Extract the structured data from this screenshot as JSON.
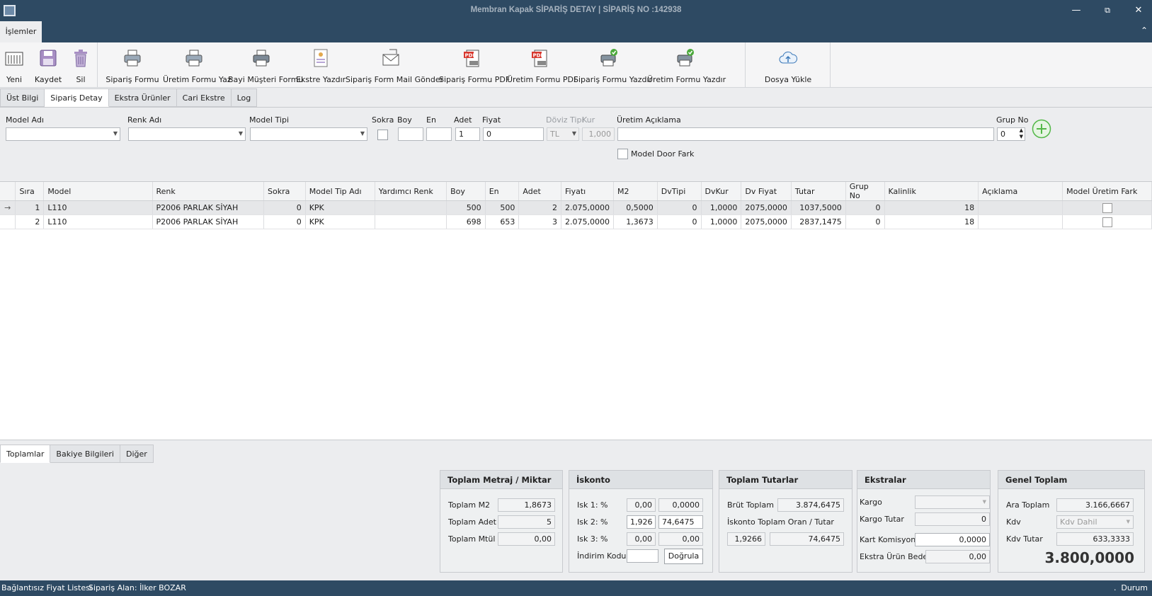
{
  "window": {
    "title": "Membran Kapak SİPARİŞ DETAY |  SİPARİŞ NO :142938"
  },
  "menu": {
    "tab": "İşlemler"
  },
  "toolbar": {
    "yeni": "Yeni",
    "kaydet": "Kaydet",
    "sil": "Sil",
    "siparis_formu": "Sipariş Formu",
    "uretim_formu_yaz": "Üretim Formu Yaz",
    "bayi_musteri_formu": "Bayi Müşteri Formu",
    "ekstre_yazdir": "Ekstre Yazdır",
    "siparis_form_mail": "Sipariş Form Mail Gönder",
    "siparis_formu_pdf": "Sipariş Formu PDF",
    "uretim_formu_pdf": "Üretim Formu PDF",
    "siparis_formu_yazdir": "Sipariş Formu Yazdır",
    "uretim_formu_yazdir": "Üretim Formu Yazdır",
    "dosya_yukle": "Dosya Yükle"
  },
  "tabs": [
    "Üst Bilgi",
    "Sipariş Detay",
    "Ekstra Ürünler",
    "Cari Ekstre",
    "Log"
  ],
  "form": {
    "model_adi": "Model Adı",
    "renk_adi": "Renk Adı",
    "model_tipi": "Model Tipi",
    "sokra": "Sokra",
    "boy": "Boy",
    "en": "En",
    "adet": "Adet",
    "fiyat": "Fiyat",
    "doviz_tipi": "Döviz Tipi",
    "kur": "Kur",
    "uretim_aciklama": "Üretim Açıklama",
    "grup_no": "Grup No",
    "adet_value": "1",
    "fiyat_value": "0",
    "doviz_value": "TL",
    "kur_value": "1,000",
    "grup_value": "0",
    "model_door_fark": "Model Door Fark"
  },
  "grid": {
    "columns": [
      "Sıra",
      "Model",
      "Renk",
      "Sokra",
      "Model Tip Adı",
      "Yardımcı Renk",
      "Boy",
      "En",
      "Adet",
      "Fiyatı",
      "M2",
      "DvTipi",
      "DvKur",
      "Dv Fiyat",
      "Tutar",
      "Grup No",
      "Kalinlik",
      "Açıklama",
      "Model Üretim Fark"
    ],
    "rows": [
      [
        "1",
        "L110",
        "P2006 PARLAK SİYAH",
        "0",
        "KPK",
        "",
        "500",
        "500",
        "2",
        "2.075,0000",
        "0,5000",
        "0",
        "1,0000",
        "2075,0000",
        "1037,5000",
        "0",
        "18",
        ""
      ],
      [
        "2",
        "L110",
        "P2006 PARLAK SİYAH",
        "0",
        "KPK",
        "",
        "698",
        "653",
        "3",
        "2.075,0000",
        "1,3673",
        "0",
        "1,0000",
        "2075,0000",
        "2837,1475",
        "0",
        "18",
        ""
      ]
    ]
  },
  "bottom_tabs": [
    "Toplamlar",
    "Bakiye Bilgileri",
    "Diğer"
  ],
  "metraj": {
    "title": "Toplam Metraj / Miktar",
    "m2_label": "Toplam M2",
    "m2": "1,8673",
    "adet_label": "Toplam Adet",
    "adet": "5",
    "mtul_label": "Toplam Mtül",
    "mtul": "0,00"
  },
  "iskonto": {
    "title": "İskonto",
    "isk1_label": "Isk 1: %",
    "isk1_pct": "0,00",
    "isk1_val": "0,0000",
    "isk2_label": "Isk 2: %",
    "isk2_pct": "1,926",
    "isk2_val": "74,6475",
    "isk3_label": "Isk 3: %",
    "isk3_pct": "0,00",
    "isk3_val": "0,00",
    "indirim_label": "İndirim Kodu",
    "dogrula": "Doğrula"
  },
  "tutarlar": {
    "title": "Toplam Tutarlar",
    "brut_label": "Brüt Toplam",
    "brut": "3.874,6475",
    "isk_label": "İskonto Toplam Oran /  Tutar",
    "isk_oran": "1,9266",
    "isk_tutar": "74,6475"
  },
  "ekstralar": {
    "title": "Ekstralar",
    "kargo_label": "Kargo",
    "kargo_tutar_label": "Kargo Tutar",
    "kargo_tutar": "0",
    "kart_label": "Kart Komisyonu",
    "kart": "0,0000",
    "ekstra_label": "Ekstra Ürün Bedeli",
    "ekstra": "0,00"
  },
  "genel": {
    "title": "Genel Toplam",
    "ara_label": "Ara Toplam",
    "ara": "3.166,6667",
    "kdv_label": "Kdv",
    "kdv": "Kdv Dahil",
    "kdv_tutar_label": "Kdv Tutar",
    "kdv_tutar": "633,3333",
    "toplam": "3.800,0000"
  },
  "status": {
    "left": "Bağlantısız Fiyat Listesi",
    "user": "Sipariş Alan: İlker BOZAR",
    "dot": ".",
    "right": "Durum"
  }
}
